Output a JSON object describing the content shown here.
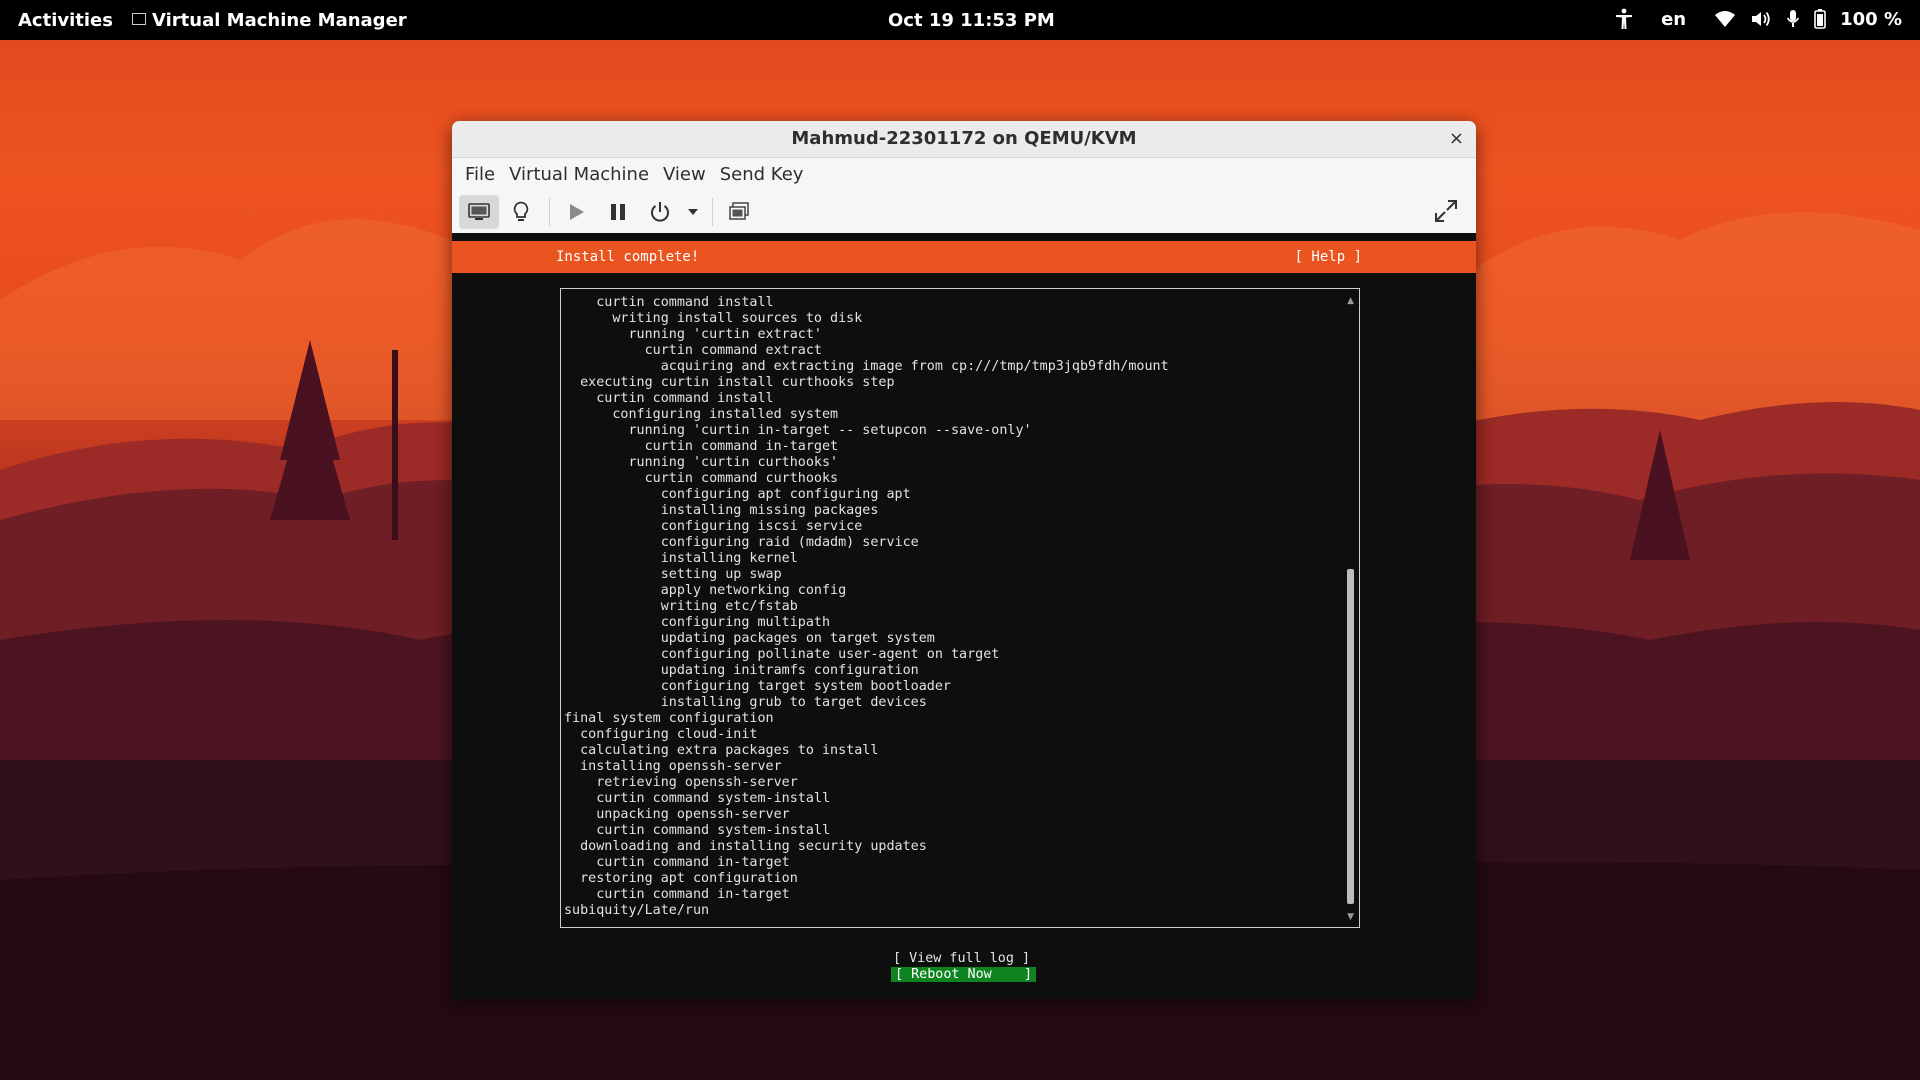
{
  "topbar": {
    "activities": "Activities",
    "app_name": "Virtual Machine Manager",
    "datetime": "Oct 19  11:53 PM",
    "language": "en",
    "battery": "100 %",
    "icons": [
      "accessibility-icon",
      "wifi-icon",
      "volume-icon",
      "microphone-icon",
      "battery-icon"
    ]
  },
  "window": {
    "title": "Mahmud-22301172 on QEMU/KVM",
    "close_label": "×",
    "menu": [
      "File",
      "Virtual Machine",
      "View",
      "Send Key"
    ],
    "toolbar": [
      "console-icon",
      "details-lightbulb-icon",
      "run-icon",
      "pause-icon",
      "power-icon",
      "power-menu-chevron-icon",
      "snapshots-icon",
      "fullscreen-icon"
    ]
  },
  "installer": {
    "header": "Install complete!",
    "help": "[ Help ]",
    "log_lines": [
      "    curtin command install",
      "      writing install sources to disk",
      "        running 'curtin extract'",
      "          curtin command extract",
      "            acquiring and extracting image from cp:///tmp/tmp3jqb9fdh/mount",
      "  executing curtin install curthooks step",
      "    curtin command install",
      "      configuring installed system",
      "        running 'curtin in-target -- setupcon --save-only'",
      "          curtin command in-target",
      "        running 'curtin curthooks'",
      "          curtin command curthooks",
      "            configuring apt configuring apt",
      "            installing missing packages",
      "            configuring iscsi service",
      "            configuring raid (mdadm) service",
      "            installing kernel",
      "            setting up swap",
      "            apply networking config",
      "            writing etc/fstab",
      "            configuring multipath",
      "            updating packages on target system",
      "            configuring pollinate user-agent on target",
      "            updating initramfs configuration",
      "            configuring target system bootloader",
      "            installing grub to target devices",
      "final system configuration",
      "  configuring cloud-init",
      "  calculating extra packages to install",
      "  installing openssh-server",
      "    retrieving openssh-server",
      "    curtin command system-install",
      "    unpacking openssh-server",
      "    curtin command system-install",
      "  downloading and installing security updates",
      "    curtin command in-target",
      "  restoring apt configuration",
      "    curtin command in-target",
      "subiquity/Late/run"
    ],
    "view_log": "[ View full log ]",
    "reboot": "[ Reboot Now    ]",
    "colors": {
      "accent": "#e95420",
      "reboot_bg": "#0e8420"
    }
  }
}
